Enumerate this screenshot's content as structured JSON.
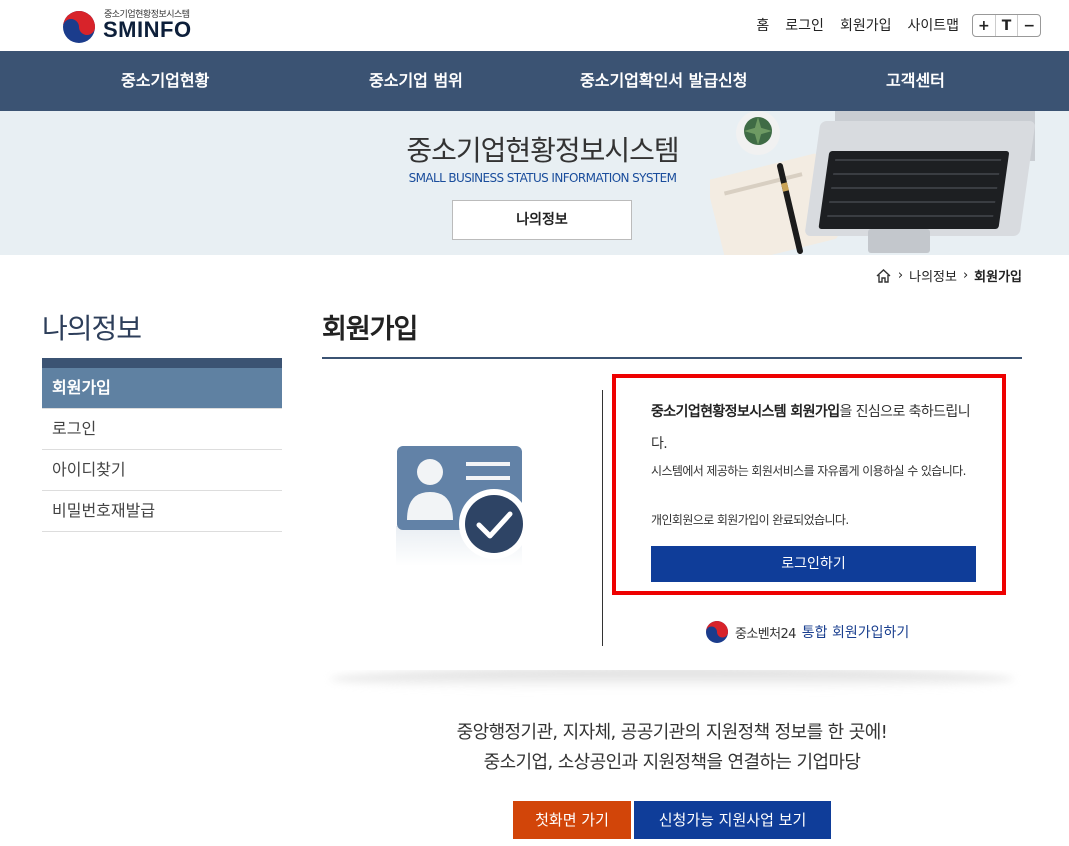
{
  "header": {
    "logo_small": "중소기업현황정보시스템",
    "logo_big": "SMINFO",
    "links": [
      "홈",
      "로그인",
      "회원가입",
      "사이트맵"
    ],
    "font_controls": [
      "+",
      "T",
      "−"
    ]
  },
  "gnb": {
    "items": [
      "중소기업현황",
      "중소기업 범위",
      "중소기업확인서 발급신청",
      "고객센터"
    ]
  },
  "banner": {
    "title": "중소기업현황정보시스템",
    "subtitle": "SMALL BUSINESS STATUS INFORMATION SYSTEM",
    "button": "나의정보"
  },
  "breadcrumb": {
    "items": [
      "나의정보",
      "회원가입"
    ]
  },
  "sidebar": {
    "title": "나의정보",
    "items": [
      "회원가입",
      "로그인",
      "아이디찾기",
      "비밀번호재발급"
    ]
  },
  "main": {
    "title": "회원가입",
    "msg_bold": "중소기업현황정보시스템 회원가입",
    "msg_rest": "을 진심으로 축하드립니다.",
    "msg_service": "시스템에서 제공하는 회원서비스를 자유롭게 이용하실 수 있습니다.",
    "msg_done": "개인회원으로 회원가입이 완료되었습니다.",
    "login_button": "로그인하기",
    "venture_label": "중소벤처24",
    "venture_link": "통합 회원가입하기"
  },
  "promo": {
    "line1": "중앙행정기관, 지자체, 공공기관의 지원정책 정보를 한 곳에!",
    "line2": "중소기업, 소상공인과 지원정책을 연결하는 기업마당",
    "btn_home": "첫화면 가기",
    "btn_support": "신청가능 지원사업 보기"
  },
  "colors": {
    "gnb": "#3b5373",
    "active_menu": "#5f81a2",
    "primary_button": "#0f3d99",
    "orange_button": "#d24509",
    "highlight_border": "#ee0000"
  }
}
